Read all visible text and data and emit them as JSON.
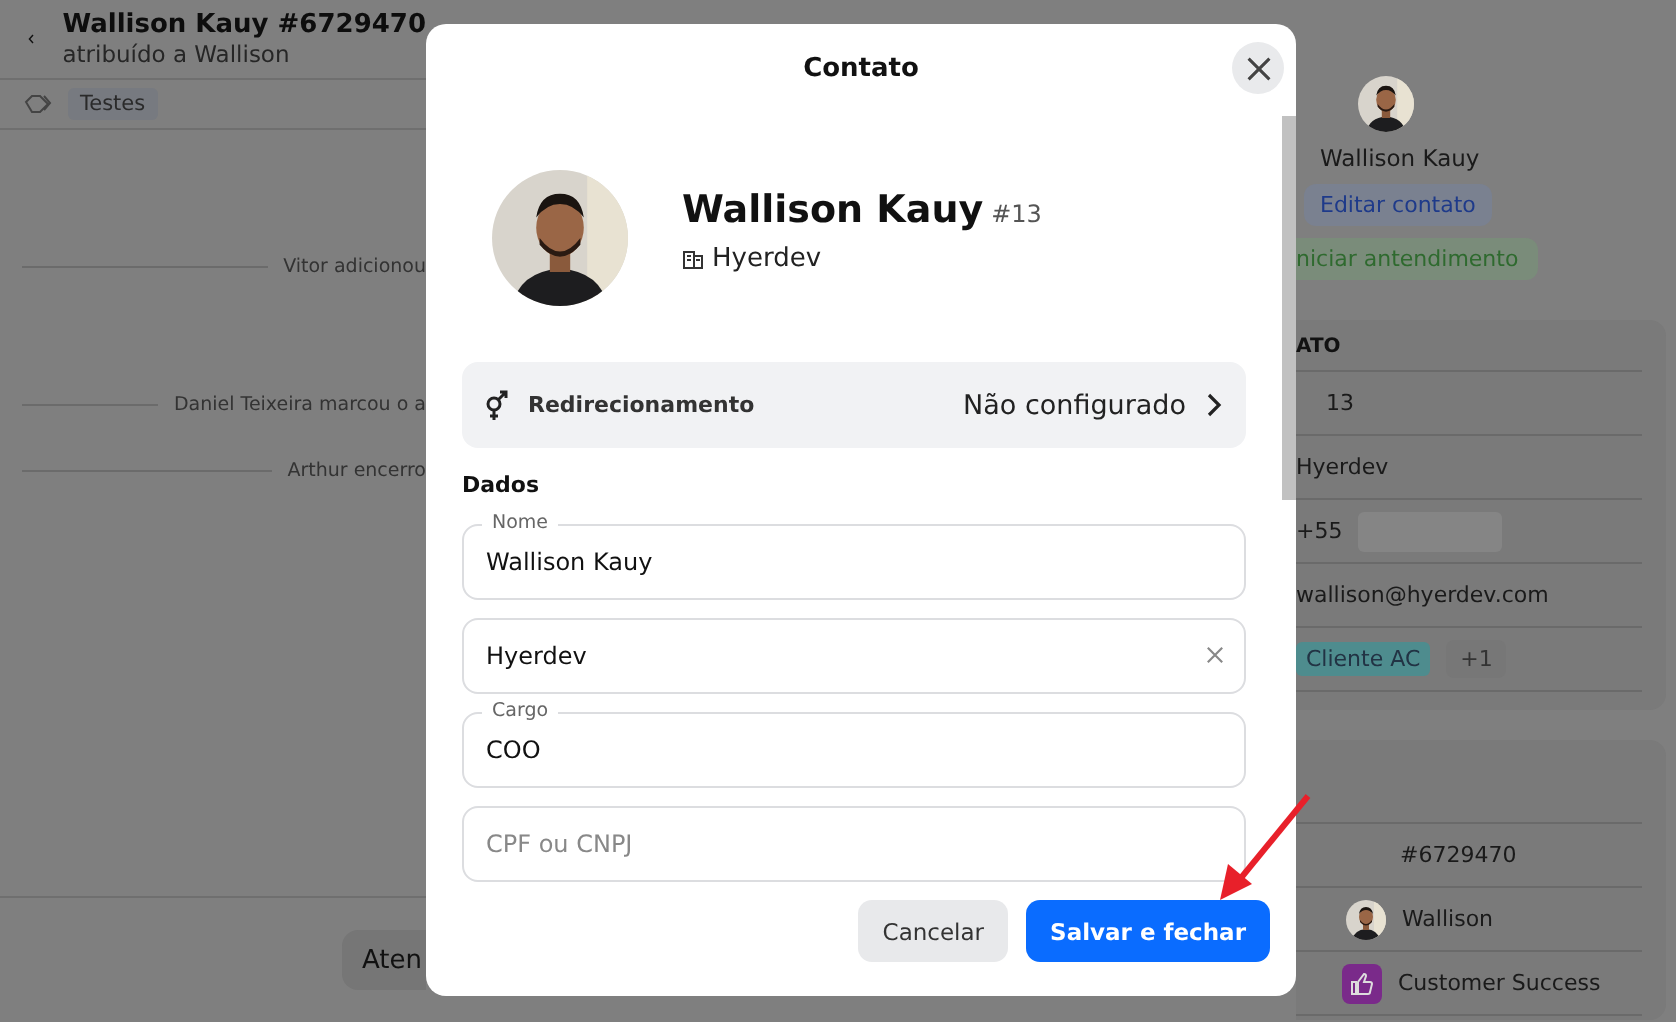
{
  "ticket_header": {
    "title": "Wallison Kauy #6729470",
    "subtitle": "atribuído a Wallison",
    "tag": "Testes"
  },
  "timeline": [
    {
      "text": "Vitor adicionou"
    },
    {
      "text": "Daniel Teixeira marcou o a"
    },
    {
      "text": "Arthur encerro"
    }
  ],
  "composer_button": "Aten",
  "contact_panel": {
    "name": "Wallison Kauy",
    "edit_button": "Editar contato",
    "start_button": "niciar antendimento",
    "section_title": "ATO",
    "rows": [
      {
        "kind": "text",
        "value": "13"
      },
      {
        "kind": "text",
        "value": "Hyerdev"
      },
      {
        "kind": "phone",
        "value": "+55"
      },
      {
        "kind": "text",
        "value": "wallison@hyerdev.com"
      },
      {
        "kind": "tags",
        "tags": [
          {
            "label": "Cliente AC",
            "color": "#4e8c8e"
          }
        ],
        "more": "+1"
      }
    ]
  },
  "ticket_panel": {
    "rows": [
      {
        "kind": "text",
        "value": "#6729470"
      },
      {
        "kind": "avatar",
        "value": "Wallison"
      },
      {
        "kind": "team",
        "value": "Customer Success"
      }
    ]
  },
  "modal": {
    "title": "Contato",
    "name": "Wallison Kauy",
    "number": "#13",
    "company": "Hyerdev",
    "redirect": {
      "label": "Redirecionamento",
      "value": "Não configurado"
    },
    "section": "Dados",
    "fields": [
      {
        "label": "Nome",
        "value": "Wallison Kauy"
      },
      {
        "value": "Hyerdev",
        "clearable": true
      },
      {
        "label": "Cargo",
        "value": "COO"
      },
      {
        "placeholder": "CPF ou CNPJ"
      }
    ],
    "buttons": [
      {
        "label": "Cancelar",
        "kind": "secondary"
      },
      {
        "label": "Salvar e fechar",
        "kind": "primary"
      }
    ]
  }
}
